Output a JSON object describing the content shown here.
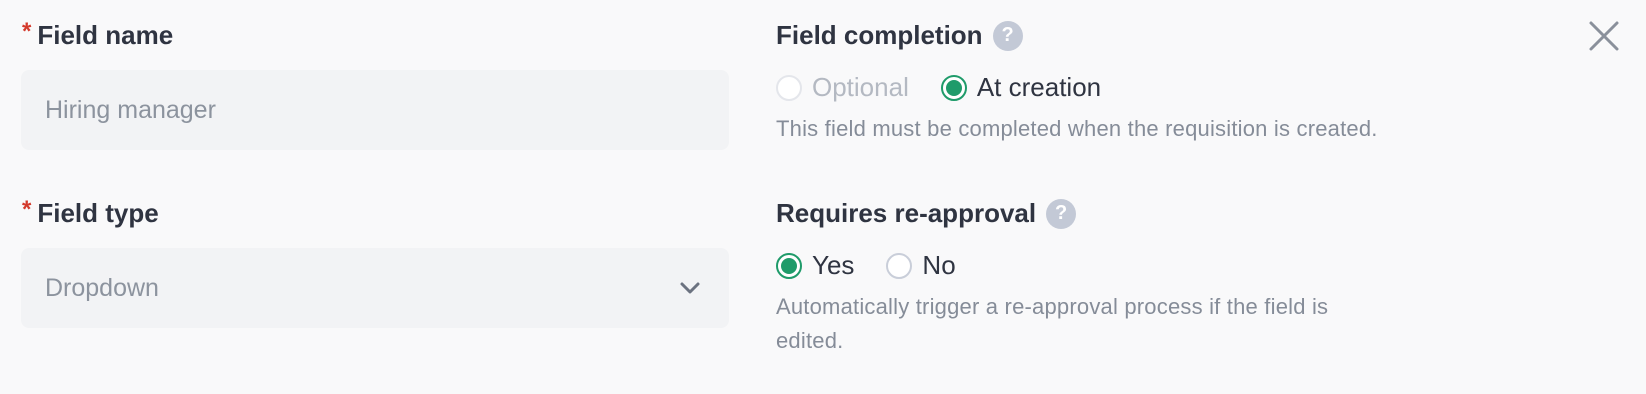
{
  "field_name": {
    "required_marker": "*",
    "label": "Field name",
    "value": "Hiring manager"
  },
  "field_type": {
    "required_marker": "*",
    "label": "Field type",
    "value": "Dropdown"
  },
  "field_completion": {
    "label": "Field completion",
    "help": "?",
    "options": [
      {
        "label": "Optional",
        "checked": false,
        "disabled": true
      },
      {
        "label": "At creation",
        "checked": true,
        "disabled": false
      }
    ],
    "description": "This field must be completed when the requisition is created."
  },
  "requires_reapproval": {
    "label": "Requires re-approval",
    "help": "?",
    "options": [
      {
        "label": "Yes",
        "checked": true,
        "disabled": false
      },
      {
        "label": "No",
        "checked": false,
        "disabled": false
      }
    ],
    "description_line1": "Automatically trigger a re-approval process if the field is",
    "description_line2": "edited."
  },
  "colors": {
    "accent": "#1f9b6a",
    "required": "#d33a2c",
    "help_icon": "#c3c9d6"
  },
  "icons": [
    "close-icon",
    "chevron-down-icon",
    "help-icon"
  ]
}
